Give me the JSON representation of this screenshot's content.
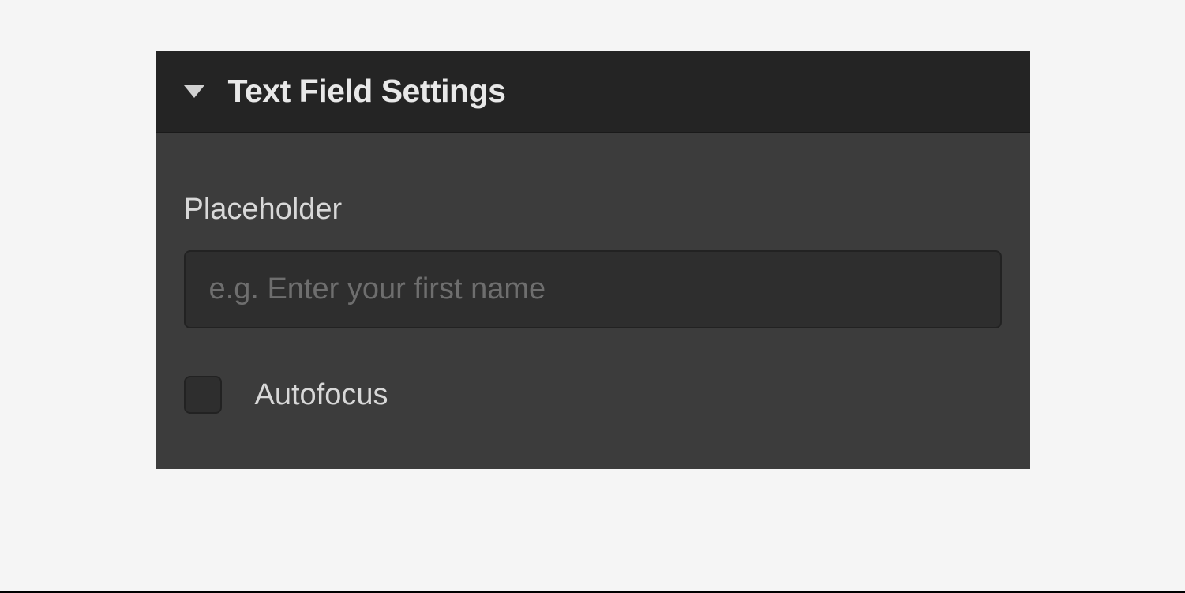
{
  "panel": {
    "title": "Text Field Settings",
    "fields": {
      "placeholder": {
        "label": "Placeholder",
        "input_placeholder": "e.g. Enter your first name",
        "value": ""
      },
      "autofocus": {
        "label": "Autofocus",
        "checked": false
      }
    }
  }
}
